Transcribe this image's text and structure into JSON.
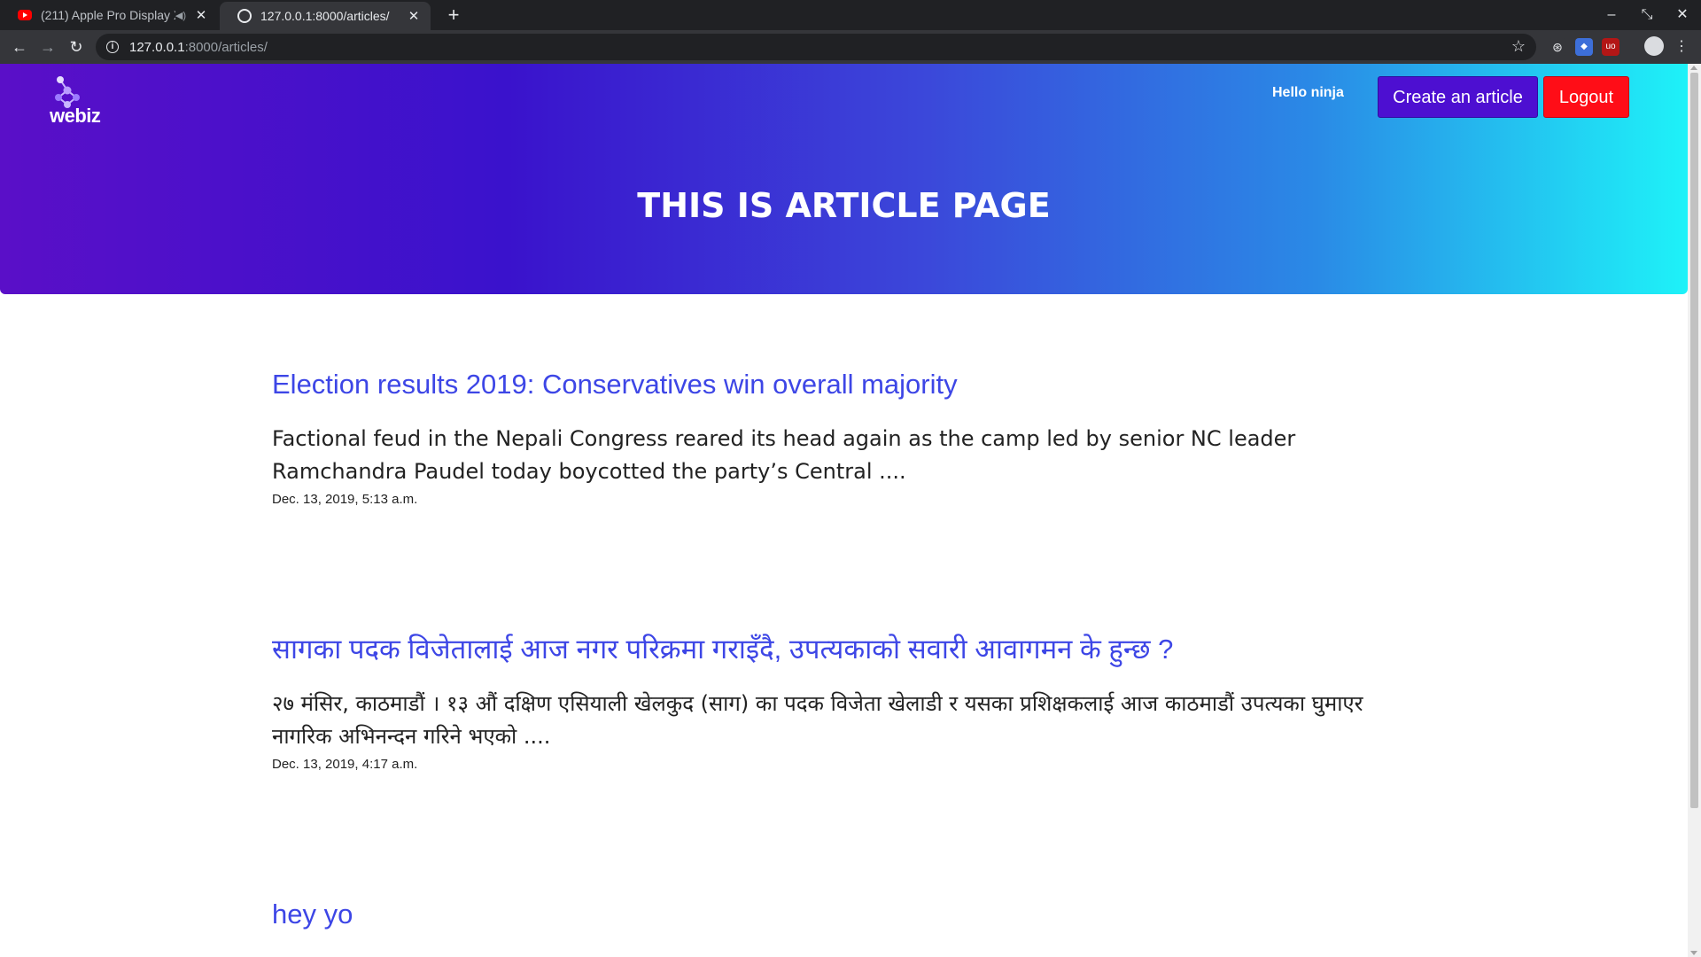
{
  "browser": {
    "tabs": [
      {
        "title": "(211) Apple Pro Display XDR",
        "favicon": "youtube-icon",
        "active": false
      },
      {
        "title": "127.0.0.1:8000/articles/",
        "favicon": "globe-icon",
        "active": true
      }
    ],
    "url_host": "127.0.0.1",
    "url_rest": ":8000/articles/"
  },
  "header": {
    "logo_text": "webiz",
    "greeting": "Hello ninja",
    "create_label": "Create an article",
    "logout_label": "Logout",
    "title": "THIS IS ARTICLE PAGE",
    "gradient_start": "#5a0fc8",
    "gradient_end": "#1ef2f8"
  },
  "articles": [
    {
      "title": "Election results 2019: Conservatives win overall majority",
      "excerpt": "Factional feud in the Nepali Congress reared its head again as the camp led by senior NC leader Ramchandra Paudel today boycotted the party’s Central ....",
      "date": "Dec. 13, 2019, 5:13 a.m."
    },
    {
      "title": "सागका पदक विजेतालाई आज नगर परिक्रमा गराइँदै, उपत्यकाको सवारी आवागमन के हुन्छ ?",
      "excerpt": "२७ मंसिर, काठमाडौं । १३ औं दक्षिण एसियाली खेलकुद (साग) का पदक विजेता खेलाडी र यसका प्रशिक्षकलाई आज काठमाडौं उपत्यका घुमाएर नागरिक अभिनन्दन गरिने भएको ....",
      "date": "Dec. 13, 2019, 4:17 a.m."
    },
    {
      "title": "hey yo"
    }
  ],
  "colors": {
    "link": "#3d46e6",
    "create_button": "#4d0fd1",
    "logout_button": "#ff0d17"
  }
}
